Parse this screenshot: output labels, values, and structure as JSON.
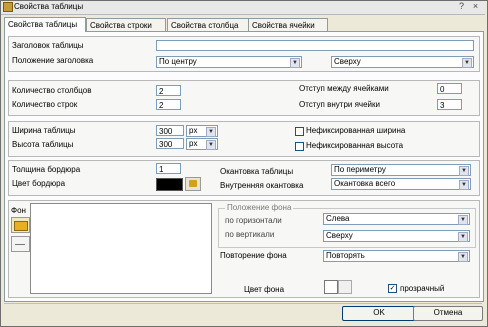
{
  "window": {
    "title": "Свойства таблицы",
    "buttons": [
      "?",
      "×"
    ]
  },
  "tabs": [
    {
      "label": "Свойства таблицы",
      "active": true
    },
    {
      "label": "Свойства строки",
      "active": false
    },
    {
      "label": "Свойства столбца",
      "active": false
    },
    {
      "label": "Свойства ячейки",
      "active": false
    }
  ],
  "caption": {
    "title_label": "Заголовок таблицы",
    "title_value": "",
    "position_label": "Положение заголовка",
    "halign_value": "По центру",
    "valign_value": "Сверху"
  },
  "size": {
    "cols_label": "Количество столбцов",
    "cols_value": "2",
    "rows_label": "Количество строк",
    "rows_value": "2",
    "spacing_label": "Отступ между ячейками",
    "spacing_value": "0",
    "padding_label": "Отступ внутри ячейки",
    "padding_value": "3"
  },
  "dims": {
    "width_label": "Ширина таблицы",
    "width_value": "300",
    "width_unit": "px",
    "height_label": "Высота таблицы",
    "height_value": "300",
    "height_unit": "px",
    "unfixed_width_label": "Нефиксированная ширина",
    "unfixed_height_label": "Нефиксированная высота"
  },
  "border": {
    "thickness_label": "Толщина бордюра",
    "thickness_value": "1",
    "color_label": "Цвет бордюра",
    "color": "#000000",
    "frame_label": "Окантовка таблицы",
    "frame_value": "По периметру",
    "rules_label": "Внутренняя окантовка",
    "rules_value": "Окантовка всего"
  },
  "background": {
    "label": "Фон",
    "position_group": "Положение фона",
    "horizontal_label": "по горизонтали",
    "horizontal_value": "Слева",
    "vertical_label": "по вертикали",
    "vertical_value": "Сверху",
    "repeat_label": "Повторение фона",
    "repeat_value": "Повторять",
    "color_label": "Цвет фона",
    "transparent_label": "прозрачный",
    "transparent_checked": true
  },
  "footer": {
    "ok_label": "OK",
    "cancel_label": "Отмена"
  }
}
